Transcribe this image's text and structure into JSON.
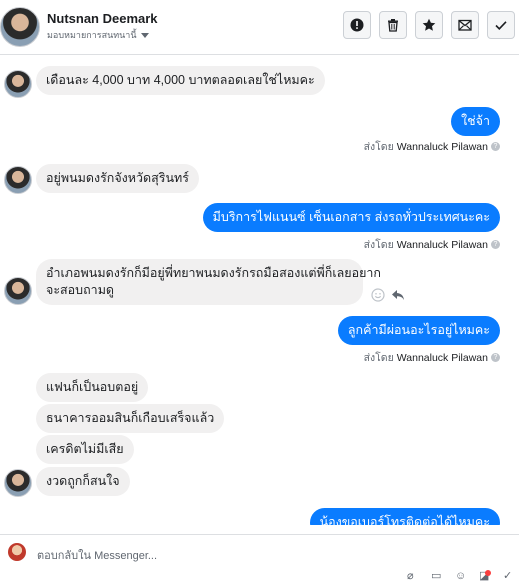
{
  "header": {
    "name": "Nutsnan Deemark",
    "assign_label": "มอบหมายการสนทนานี้"
  },
  "actions": [
    {
      "name": "mark-spam-button",
      "icon": "exclamation-icon"
    },
    {
      "name": "delete-button",
      "icon": "trash-icon"
    },
    {
      "name": "star-button",
      "icon": "star-icon"
    },
    {
      "name": "mark-unread-button",
      "icon": "envelope-icon"
    },
    {
      "name": "mark-done-button",
      "icon": "check-icon"
    }
  ],
  "messages": {
    "m1": "เดือนละ 4,000 บาท 4,000 บาทตลอดเลยใช่ไหมคะ",
    "m2": "ใช่จ้า",
    "m3": "อยู่พนมดงรักจังหวัดสุรินทร์",
    "m4": "มีบริการไฟแนนซ์ เซ็นเอกสาร ส่งรถทั่วประเทศนะคะ",
    "m5_line1": "อำเภอพนมดงรักก็มีอยู่พี่ทยาพนมดงรักรถมือสองแต่พี่ก็เลยอยาก",
    "m5_line2": "จะสอบถามดู",
    "m6": "ลูกค้ามีผ่อนอะไรอยู่ไหมคะ",
    "m7": "แฟนก็เป็นอบตอยู่",
    "m8": "ธนาคารออมสินก็เกือบเสร็จแล้ว",
    "m9": "เครดิตไม่มีเสีย",
    "m10": "งวดถูกก็สนใจ",
    "m11": "น้องขอเบอร์โทรติดต่อได้ไหมคะ"
  },
  "sent_by": {
    "prefix": "ส่งโดย",
    "agent": "Wannaluck Pilawan",
    "help": "?"
  },
  "composer": {
    "placeholder": "ตอบกลับใน Messenger..."
  },
  "colors": {
    "outgoing_bubble": "#0a7cff",
    "incoming_bubble": "#f1f0f0"
  }
}
